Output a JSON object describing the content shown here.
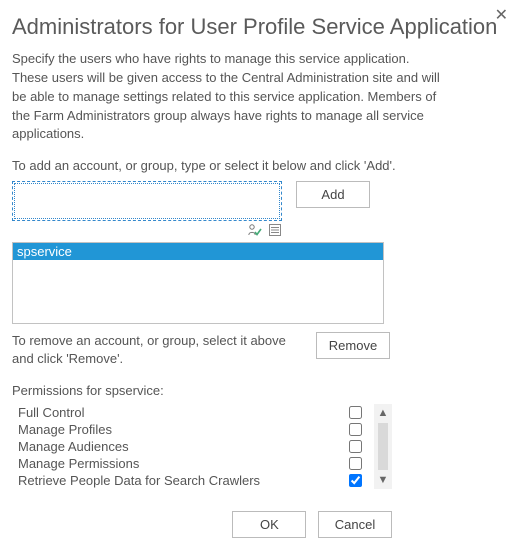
{
  "dialog": {
    "title": "Administrators for User Profile Service Application",
    "description": "Specify the users who have rights to manage this service application. These users will be given access to the Central Administration site and will be able to manage settings related to this service application. Members of the Farm Administrators group always have rights to manage all service applications.",
    "add_instruction": "To add an account, or group, type or select it below and click 'Add'.",
    "remove_instruction": "To remove an account, or group, select it above and click 'Remove'.",
    "close_glyph": "✕"
  },
  "buttons": {
    "add": "Add",
    "remove": "Remove",
    "ok": "OK",
    "cancel": "Cancel"
  },
  "picker": {
    "value": "",
    "check_icon": "✔",
    "browse_icon": "🗒"
  },
  "admins": {
    "items": [
      "spservice"
    ]
  },
  "permissions": {
    "label": "Permissions for spservice:",
    "rows": [
      {
        "label": "Full Control",
        "checked": false
      },
      {
        "label": "Manage Profiles",
        "checked": false
      },
      {
        "label": "Manage Audiences",
        "checked": false
      },
      {
        "label": "Manage Permissions",
        "checked": false
      },
      {
        "label": "Retrieve People Data for Search Crawlers",
        "checked": true
      }
    ],
    "scroll_up": "▲",
    "scroll_down": "▼"
  }
}
